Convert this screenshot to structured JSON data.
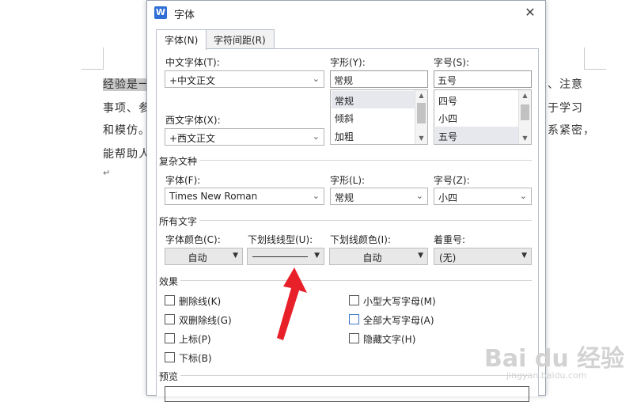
{
  "document": {
    "lines": [
      {
        "left": "经验是一",
        "right": "、注意"
      },
      {
        "left": "事项、参",
        "right": "于学习"
      },
      {
        "left": "和模仿。",
        "right": "系紧密，"
      },
      {
        "left": "能帮助人",
        "right": ""
      }
    ],
    "paragraph_mark": "↵"
  },
  "dialog": {
    "title": "字体",
    "app_icon": "W",
    "close": "✕",
    "tabs": [
      {
        "label": "字体(N)",
        "active": true
      },
      {
        "label": "字符间距(R)",
        "active": false
      }
    ],
    "chinese_font": {
      "label": "中文字体(T):",
      "value": "+中文正文"
    },
    "western_font": {
      "label": "西文字体(X):",
      "value": "+西文正文"
    },
    "style": {
      "label": "字形(Y):",
      "value": "常规",
      "options": [
        "常规",
        "倾斜",
        "加粗"
      ],
      "selected_index": 0
    },
    "size": {
      "label": "字号(S):",
      "value": "五号",
      "options": [
        "四号",
        "小四",
        "五号"
      ],
      "selected_index": 2
    },
    "complex": {
      "section": "复杂文种",
      "font_label": "字体(F):",
      "font_value": "Times New Roman",
      "style_label": "字形(L):",
      "style_value": "常规",
      "size_label": "字号(Z):",
      "size_value": "小四"
    },
    "all_text": {
      "section": "所有文字",
      "color_label": "字体颜色(C):",
      "color_value": "自动",
      "underline_label": "下划线线型(U):",
      "underline_color_label": "下划线颜色(I):",
      "underline_color_value": "自动",
      "emphasis_label": "着重号:",
      "emphasis_value": "(无)"
    },
    "effects": {
      "section": "效果",
      "left": [
        "删除线(K)",
        "双删除线(G)",
        "上标(P)",
        "下标(B)"
      ],
      "right": [
        "小型大写字母(M)",
        "全部大写字母(A)",
        "隐藏文字(H)"
      ]
    },
    "preview": {
      "section": "预览"
    }
  },
  "colors": {
    "annotation_arrow": "#e8202a",
    "accent_checkbox": "#3b79c9",
    "app_icon": "#2f6fd6"
  },
  "watermark": {
    "main": "Bai du 经验",
    "sub": "jingyan.baidu.com"
  }
}
